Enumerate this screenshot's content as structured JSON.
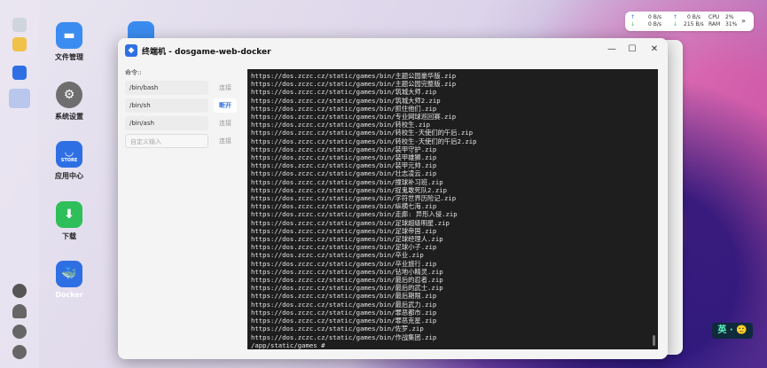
{
  "desktop": {
    "icons": [
      {
        "label": "文件管理",
        "icon": "folder-icon",
        "color": "#3b8cf0"
      },
      {
        "label": "系统设置",
        "icon": "gear-icon",
        "color": "#6e6e6e"
      },
      {
        "label": "应用中心",
        "icon": "store-icon",
        "color": "#2f6fe4"
      },
      {
        "label": "下载",
        "icon": "download-icon",
        "color": "#2fbf5a"
      },
      {
        "label": "Docker",
        "icon": "docker-icon",
        "color": "#2f6fe4"
      }
    ],
    "store_badge": "STORE"
  },
  "sysmon": {
    "up_label": "0 B/s",
    "down_label": "0 B/s",
    "up2_label": "0 B/s",
    "down2_label": "215 B/s",
    "cpu_label": "CPU",
    "ram_label": "RAM",
    "cpu_value": "2%",
    "ram_value": "31%"
  },
  "window": {
    "title": "终端机 - dosgame-web-docker",
    "minimize_glyph": "—",
    "maximize_glyph": "☐",
    "close_glyph": "✕"
  },
  "commands": {
    "label": "命令::",
    "items": [
      {
        "value": "/bin/bash",
        "action": "连接"
      },
      {
        "value": "/bin/sh",
        "action": "断开"
      },
      {
        "value": "/bin/ash",
        "action": "连接"
      }
    ],
    "custom_placeholder": "自定义输入",
    "custom_action": "连接"
  },
  "terminal": {
    "lines": [
      "https://dos.zczc.cz/static/games/bin/主题公园豪华版.zip",
      "https://dos.zczc.cz/static/games/bin/主题公园完整版.zip",
      "https://dos.zczc.cz/static/games/bin/筑城大师.zip",
      "https://dos.zczc.cz/static/games/bin/筑城大师2.zip",
      "https://dos.zczc.cz/static/games/bin/抓住他们.zip",
      "https://dos.zczc.cz/static/games/bin/专业网球巡回赛.zip",
      "https://dos.zczc.cz/static/games/bin/转校生.zip",
      "https://dos.zczc.cz/static/games/bin/转校生-天使们的午后.zip",
      "https://dos.zczc.cz/static/games/bin/转校生-天使们的午后2.zip",
      "https://dos.zczc.cz/static/games/bin/装甲守护.zip",
      "https://dos.zczc.cz/static/games/bin/装甲雄狮.zip",
      "https://dos.zczc.cz/static/games/bin/装甲元帅.zip",
      "https://dos.zczc.cz/static/games/bin/壮志凌云.zip",
      "https://dos.zczc.cz/static/games/bin/撞球补习班.zip",
      "https://dos.zczc.cz/static/games/bin/捉鬼敢死队2.zip",
      "https://dos.zczc.cz/static/games/bin/字符世界历险记.zip",
      "https://dos.zczc.cz/static/games/bin/纵横七海.zip",
      "https://dos.zczc.cz/static/games/bin/走廊: 异形入侵.zip",
      "https://dos.zczc.cz/static/games/bin/足球超级明星.zip",
      "https://dos.zczc.cz/static/games/bin/足球帝国.zip",
      "https://dos.zczc.cz/static/games/bin/足球经理人.zip",
      "https://dos.zczc.cz/static/games/bin/足球小子.zip",
      "https://dos.zczc.cz/static/games/bin/卒业.zip",
      "https://dos.zczc.cz/static/games/bin/卒业旅行.zip",
      "https://dos.zczc.cz/static/games/bin/钻地小精灵.zip",
      "https://dos.zczc.cz/static/games/bin/最后的忍者.zip",
      "https://dos.zczc.cz/static/games/bin/最后的武士.zip",
      "https://dos.zczc.cz/static/games/bin/最后期限.zip",
      "https://dos.zczc.cz/static/games/bin/最后武力.zip",
      "https://dos.zczc.cz/static/games/bin/罪恶都市.zip",
      "https://dos.zczc.cz/static/games/bin/罪恶克星.zip",
      "https://dos.zczc.cz/static/games/bin/佐罗.zip",
      "https://dos.zczc.cz/static/games/bin/作战集团.zip",
      "/app/static/games # "
    ]
  },
  "ime": {
    "label": "英 · 🙂"
  }
}
